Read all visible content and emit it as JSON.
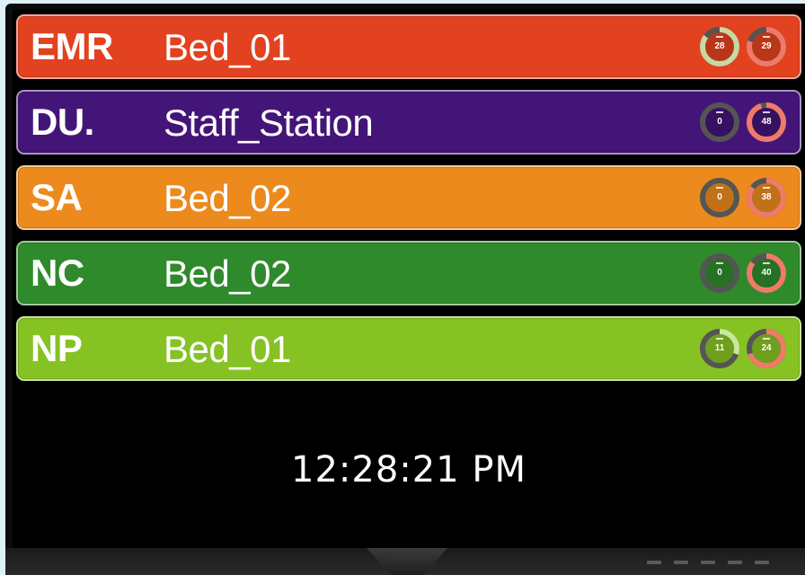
{
  "rows": [
    {
      "code": "EMR",
      "location": "Bed_01",
      "color": "#e2421f",
      "gauges": [
        {
          "value": "28",
          "fraction": 0.85,
          "ring": "#c8d8a0"
        },
        {
          "value": "29",
          "fraction": 0.8,
          "ring": "#f07a6a"
        }
      ]
    },
    {
      "code": "DU.",
      "location": "Staff_Station",
      "color": "#431578",
      "gauges": [
        {
          "value": "0",
          "fraction": 0.0,
          "ring": "#cfcfcf"
        },
        {
          "value": "48",
          "fraction": 0.95,
          "ring": "#f07a6a"
        }
      ]
    },
    {
      "code": "SA",
      "location": "Bed_02",
      "color": "#ec8a1e",
      "gauges": [
        {
          "value": "0",
          "fraction": 0.0,
          "ring": "#cfcfcf"
        },
        {
          "value": "38",
          "fraction": 0.85,
          "ring": "#f07a6a"
        }
      ]
    },
    {
      "code": "NC",
      "location": "Bed_02",
      "color": "#2f8a2c",
      "gauges": [
        {
          "value": "0",
          "fraction": 0.0,
          "ring": "#cfcfcf"
        },
        {
          "value": "40",
          "fraction": 0.85,
          "ring": "#f07a6a"
        }
      ]
    },
    {
      "code": "NP",
      "location": "Bed_01",
      "color": "#87c224",
      "gauges": [
        {
          "value": "11",
          "fraction": 0.3,
          "ring": "#c8e8a0"
        },
        {
          "value": "24",
          "fraction": 0.7,
          "ring": "#f07a6a"
        }
      ]
    }
  ],
  "clock": "12:28:21 PM"
}
